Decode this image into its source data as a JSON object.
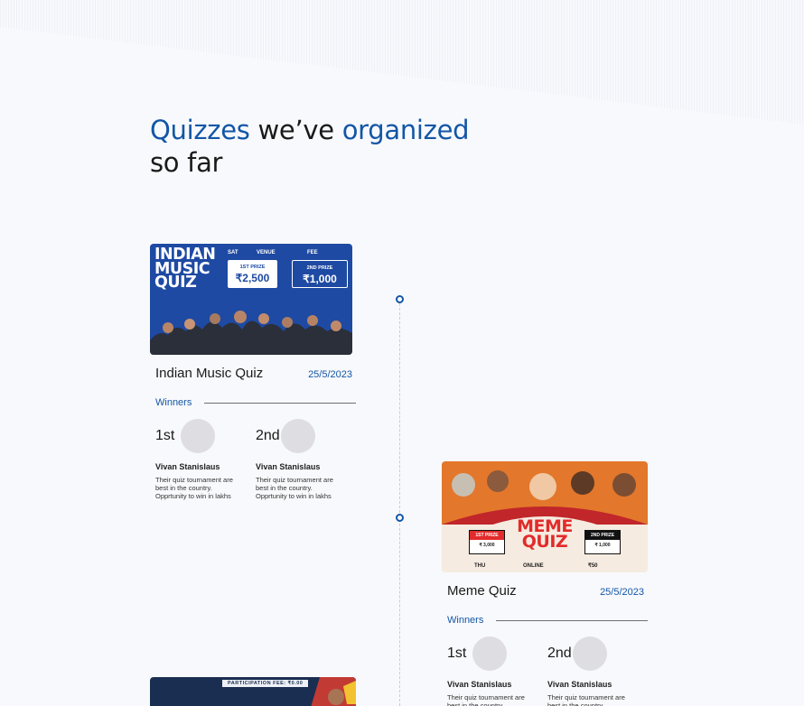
{
  "heading": {
    "word1": "Quizzes",
    "word2": " we’ve ",
    "word3": "organized",
    "line2": "so far"
  },
  "cards": [
    {
      "title": "Indian Music Quiz",
      "date": "25/5/2023",
      "winners_label": "Winners",
      "banner": {
        "title_lines": [
          "INDIAN",
          "MUSIC",
          "QUIZ"
        ],
        "day": "SAT",
        "venue_label": "VENUE",
        "fee_label": "FEE",
        "first_prize_label": "1ST PRIZE",
        "first_prize_value": "₹2,500",
        "second_prize_label": "2ND PRIZE",
        "second_prize_value": "₹1,000"
      },
      "winners": [
        {
          "place": "1st",
          "name": "Vivan Stanislaus",
          "desc": "Their quiz tournament are best in the country. Opprtunity to win in lakhs"
        },
        {
          "place": "2nd",
          "name": "Vivan Stanislaus",
          "desc": "Their quiz tournament are best in the country. Opprtunity to win in lakhs"
        }
      ]
    },
    {
      "title": "Meme Quiz",
      "date": "25/5/2023",
      "winners_label": "Winners",
      "banner": {
        "title": "MEME QUIZ",
        "first_prize_label": "1ST PRIZE",
        "first_prize_value": "₹ 3,000",
        "second_prize_label": "2ND PRIZE",
        "second_prize_value": "₹ 1,000",
        "day": "THU",
        "mode": "ONLINE",
        "fee": "₹50"
      },
      "winners": [
        {
          "place": "1st",
          "name": "Vivan Stanislaus",
          "desc": "Their quiz tournament are best in the country. Opprtunity to win in lakhs"
        },
        {
          "place": "2nd",
          "name": "Vivan Stanislaus",
          "desc": "Their quiz tournament are best in the country. Opprtunity to win in lakhs"
        }
      ]
    }
  ],
  "third_banner": {
    "fee_text": "PARTICIPATION FEE: ₹0.00"
  },
  "colors": {
    "accent": "#1356a6",
    "background": "#f8f9fc"
  }
}
